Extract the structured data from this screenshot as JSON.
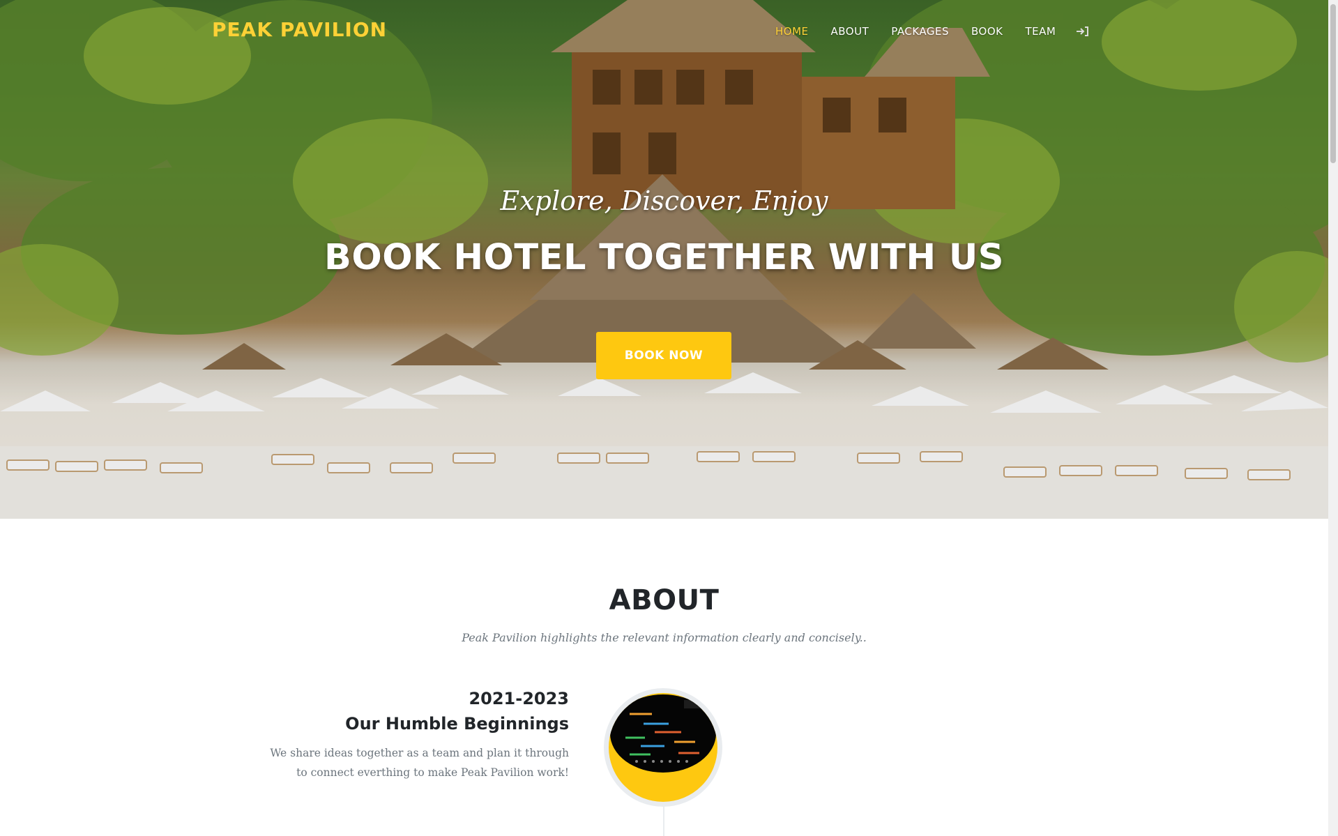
{
  "brand": "PEAK PAVILION",
  "nav": {
    "items": [
      {
        "label": "HOME",
        "active": true
      },
      {
        "label": "ABOUT"
      },
      {
        "label": "PACKAGES"
      },
      {
        "label": "BOOK"
      },
      {
        "label": "TEAM"
      }
    ],
    "login_icon": "sign-in-icon"
  },
  "hero": {
    "subheading": "Explore, Discover, Enjoy",
    "heading": "BOOK HOTEL TOGETHER WITH US",
    "cta_label": "BOOK NOW"
  },
  "about": {
    "title": "ABOUT",
    "subtitle": "Peak Pavilion highlights the relevant information clearly and concisely..",
    "timeline": [
      {
        "date": "2021-2023",
        "title": "Our Humble Beginnings",
        "body_line1": "We share ideas together as a team and plan it through",
        "body_line2": "to connect everthing to make Peak Pavilion work!"
      }
    ]
  },
  "colors": {
    "accent": "#fec810",
    "brand_text": "#fed136",
    "heading": "#212529",
    "muted": "#6c757d"
  }
}
